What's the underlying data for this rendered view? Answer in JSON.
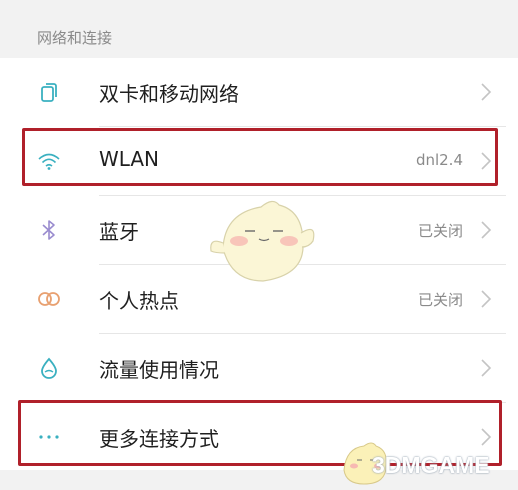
{
  "section": {
    "title": "网络和连接"
  },
  "rows": [
    {
      "label": "双卡和移动网络",
      "value": "",
      "icon": "dual-sim-icon"
    },
    {
      "label": "WLAN",
      "value": "dnl2.4",
      "icon": "wifi-icon"
    },
    {
      "label": "蓝牙",
      "value": "已关闭",
      "icon": "bluetooth-icon"
    },
    {
      "label": "个人热点",
      "value": "已关闭",
      "icon": "hotspot-icon"
    },
    {
      "label": "流量使用情况",
      "value": "",
      "icon": "data-drop-icon"
    },
    {
      "label": "更多连接方式",
      "value": "",
      "icon": "more-dots-icon"
    }
  ],
  "highlights": [
    "WLAN",
    "更多连接方式"
  ],
  "colors": {
    "highlight_border": "#b0202a",
    "icon_teal": "#3ab0c0",
    "icon_purple": "#9a8ccf",
    "icon_orange": "#e8a070",
    "section_bg": "#f2f2f2"
  },
  "watermark": {
    "text": "3DMGAME"
  }
}
